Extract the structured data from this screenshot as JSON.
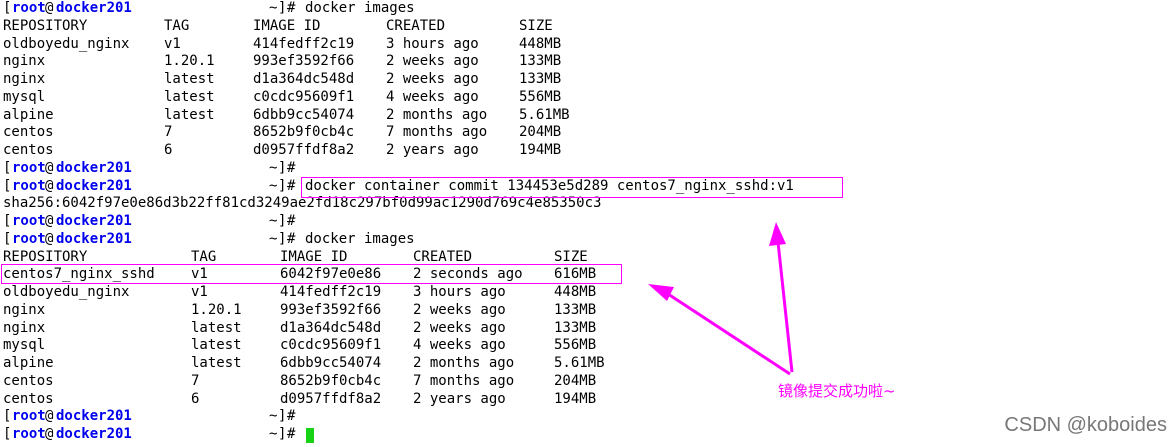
{
  "prompt": {
    "open": "[",
    "user": "root",
    "at": "@",
    "host": "docker201",
    "dir": "~",
    "close": "]",
    "hash": "#"
  },
  "commands": {
    "images": "docker images",
    "commit": "docker container commit 134453e5d289 centos7_nginx_sshd:v1"
  },
  "commit_output": "sha256:6042f97e0e86d3b22ff81cd3249ae2fd18c297bf0d99ac1290d769c4e85350c3",
  "table1": {
    "headers": [
      "REPOSITORY",
      "TAG",
      "IMAGE ID",
      "CREATED",
      "SIZE"
    ],
    "rows": [
      [
        "oldboyedu_nginx",
        "v1",
        "414fedff2c19",
        "3 hours ago",
        "448MB"
      ],
      [
        "nginx",
        "1.20.1",
        "993ef3592f66",
        "2 weeks ago",
        "133MB"
      ],
      [
        "nginx",
        "latest",
        "d1a364dc548d",
        "2 weeks ago",
        "133MB"
      ],
      [
        "mysql",
        "latest",
        "c0cdc95609f1",
        "4 weeks ago",
        "556MB"
      ],
      [
        "alpine",
        "latest",
        "6dbb9cc54074",
        "2 months ago",
        "5.61MB"
      ],
      [
        "centos",
        "7",
        "8652b9f0cb4c",
        "7 months ago",
        "204MB"
      ],
      [
        "centos",
        "6",
        "d0957ffdf8a2",
        "2 years ago",
        "194MB"
      ]
    ]
  },
  "table2": {
    "headers": [
      "REPOSITORY",
      "TAG",
      "IMAGE ID",
      "CREATED",
      "SIZE"
    ],
    "rows": [
      [
        "centos7_nginx_sshd",
        "v1",
        "6042f97e0e86",
        "2 seconds ago",
        "616MB"
      ],
      [
        "oldboyedu_nginx",
        "v1",
        "414fedff2c19",
        "3 hours ago",
        "448MB"
      ],
      [
        "nginx",
        "1.20.1",
        "993ef3592f66",
        "2 weeks ago",
        "133MB"
      ],
      [
        "nginx",
        "latest",
        "d1a364dc548d",
        "2 weeks ago",
        "133MB"
      ],
      [
        "mysql",
        "latest",
        "c0cdc95609f1",
        "4 weeks ago",
        "556MB"
      ],
      [
        "alpine",
        "latest",
        "6dbb9cc54074",
        "2 months ago",
        "5.61MB"
      ],
      [
        "centos",
        "7",
        "8652b9f0cb4c",
        "7 months ago",
        "204MB"
      ],
      [
        "centos",
        "6",
        "d0957ffdf8a2",
        "2 years ago",
        "194MB"
      ]
    ]
  },
  "annotation": {
    "text": "镜像提交成功啦~",
    "color": "#ff00ff"
  },
  "watermark": "CSDN @koboides",
  "colors": {
    "prompt_user": "#0000ee",
    "cursor": "#16d316",
    "highlight": "#ff00ff"
  }
}
